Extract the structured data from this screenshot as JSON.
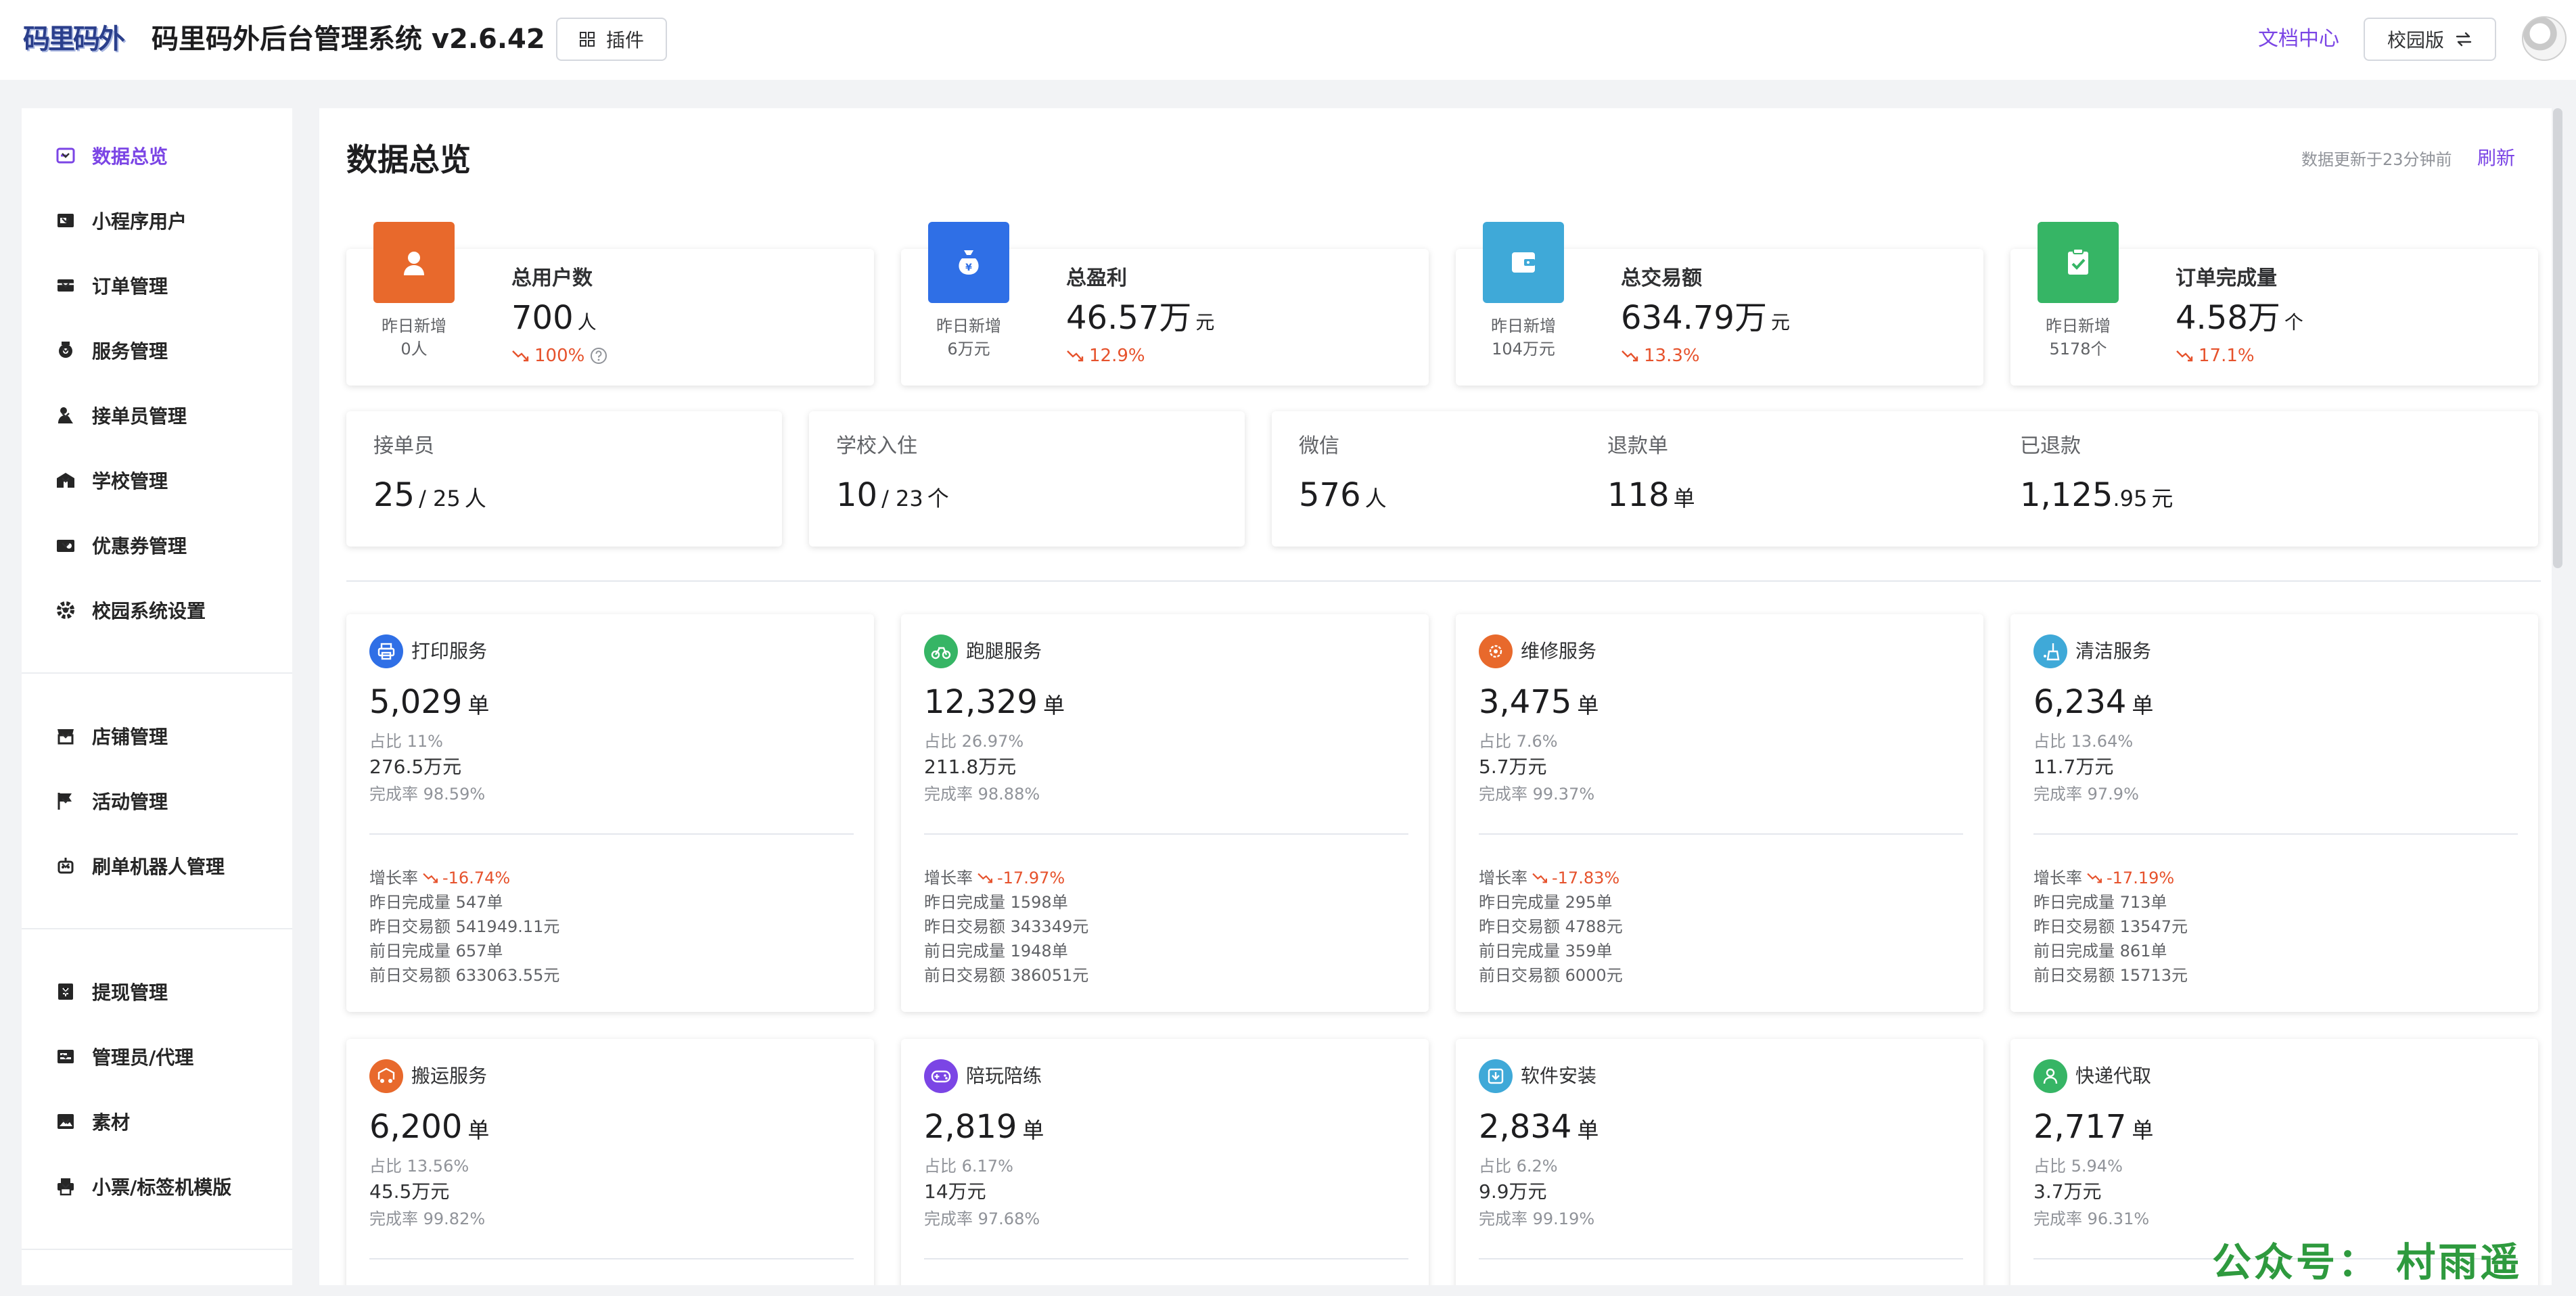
{
  "header": {
    "logo_text": "码里码外",
    "title": "码里码外后台管理系统 v2.6.42",
    "plugin_label": "插件",
    "docs_label": "文档中心",
    "school_label": "校园版"
  },
  "sidebar": {
    "groups": [
      [
        {
          "label": "数据总览",
          "icon": "dashboard-icon",
          "active": true
        },
        {
          "label": "小程序用户",
          "icon": "users-icon"
        },
        {
          "label": "订单管理",
          "icon": "orders-icon"
        },
        {
          "label": "服务管理",
          "icon": "service-icon"
        },
        {
          "label": "接单员管理",
          "icon": "runner-icon"
        },
        {
          "label": "学校管理",
          "icon": "school-icon"
        },
        {
          "label": "优惠券管理",
          "icon": "coupon-icon"
        },
        {
          "label": "校园系统设置",
          "icon": "settings-icon"
        }
      ],
      [
        {
          "label": "店铺管理",
          "icon": "shop-icon"
        },
        {
          "label": "活动管理",
          "icon": "flag-icon"
        },
        {
          "label": "刷单机器人管理",
          "icon": "robot-icon"
        }
      ],
      [
        {
          "label": "提现管理",
          "icon": "withdraw-icon"
        },
        {
          "label": "管理员/代理",
          "icon": "admin-icon"
        },
        {
          "label": "素材",
          "icon": "image-icon"
        },
        {
          "label": "小票/标签机模版",
          "icon": "printer-icon"
        }
      ]
    ]
  },
  "main": {
    "title": "数据总览",
    "updated_text": "数据更新于23分钟前",
    "refresh_label": "刷新"
  },
  "stats": [
    {
      "icon": "user-icon",
      "color": "#e8692c",
      "yesterday_label": "昨日新增",
      "yesterday_value": "0人",
      "label": "总用户数",
      "value": "700",
      "unit": "人",
      "trend": "100%",
      "help": true
    },
    {
      "icon": "money-bag-icon",
      "color": "#2f6fe6",
      "yesterday_label": "昨日新增",
      "yesterday_value": "6万元",
      "label": "总盈利",
      "value": "46.57万",
      "unit": "元",
      "trend": "12.9%"
    },
    {
      "icon": "wallet-icon",
      "color": "#3fa9d8",
      "yesterday_label": "昨日新增",
      "yesterday_value": "104万元",
      "label": "总交易额",
      "value": "634.79万",
      "unit": "元",
      "trend": "13.3%"
    },
    {
      "icon": "clipboard-check-icon",
      "color": "#36b565",
      "yesterday_label": "昨日新增",
      "yesterday_value": "5178个",
      "label": "订单完成量",
      "value": "4.58万",
      "unit": "个",
      "trend": "17.1%"
    }
  ],
  "metrics": {
    "runners": {
      "label": "接单员",
      "value": "25",
      "total": "/ 25",
      "unit": "人"
    },
    "schools": {
      "label": "学校入住",
      "value": "10",
      "total": "/ 23",
      "unit": "个"
    },
    "wechat": {
      "label": "微信",
      "value": "576",
      "unit": "人"
    },
    "refund_orders": {
      "label": "退款单",
      "value": "118",
      "unit": "单"
    },
    "refunded": {
      "label": "已退款",
      "value": "1,125",
      "decimal": ".95",
      "unit": "元"
    }
  },
  "services": [
    {
      "name": "打印服务",
      "icon": "printer-service-icon",
      "color": "#2f6fe6",
      "count": "5,029",
      "unit": "单",
      "pct": "占比 11%",
      "amount": "276.5万元",
      "completion": "完成率 98.59%",
      "growth_label": "增长率",
      "growth": "-16.74%",
      "d1": "昨日完成量 547单",
      "d2": "昨日交易额 541949.11元",
      "d3": "前日完成量 657单",
      "d4": "前日交易额 633063.55元"
    },
    {
      "name": "跑腿服务",
      "icon": "bike-icon",
      "color": "#36b565",
      "count": "12,329",
      "unit": "单",
      "pct": "占比 26.97%",
      "amount": "211.8万元",
      "completion": "完成率 98.88%",
      "growth_label": "增长率",
      "growth": "-17.97%",
      "d1": "昨日完成量 1598单",
      "d2": "昨日交易额 343349元",
      "d3": "前日完成量 1948单",
      "d4": "前日交易额 386051元"
    },
    {
      "name": "维修服务",
      "icon": "repair-icon",
      "color": "#e8692c",
      "count": "3,475",
      "unit": "单",
      "pct": "占比 7.6%",
      "amount": "5.7万元",
      "completion": "完成率 99.37%",
      "growth_label": "增长率",
      "growth": "-17.83%",
      "d1": "昨日完成量 295单",
      "d2": "昨日交易额 4788元",
      "d3": "前日完成量 359单",
      "d4": "前日交易额 6000元"
    },
    {
      "name": "清洁服务",
      "icon": "broom-icon",
      "color": "#3fa9d8",
      "count": "6,234",
      "unit": "单",
      "pct": "占比 13.64%",
      "amount": "11.7万元",
      "completion": "完成率 97.9%",
      "growth_label": "增长率",
      "growth": "-17.19%",
      "d1": "昨日完成量 713单",
      "d2": "昨日交易额 13547元",
      "d3": "前日完成量 861单",
      "d4": "前日交易额 15713元"
    },
    {
      "name": "搬运服务",
      "icon": "truck-icon",
      "color": "#e8692c",
      "count": "6,200",
      "unit": "单",
      "pct": "占比 13.56%",
      "amount": "45.5万元",
      "completion": "完成率 99.82%"
    },
    {
      "name": "陪玩陪练",
      "icon": "gamepad-icon",
      "color": "#7b45e5",
      "count": "2,819",
      "unit": "单",
      "pct": "占比 6.17%",
      "amount": "14万元",
      "completion": "完成率 97.68%"
    },
    {
      "name": "软件安装",
      "icon": "install-icon",
      "color": "#3fa9d8",
      "count": "2,834",
      "unit": "单",
      "pct": "占比 6.2%",
      "amount": "9.9万元",
      "completion": "完成率 99.19%"
    },
    {
      "name": "快递代取",
      "icon": "courier-icon",
      "color": "#36b565",
      "count": "2,717",
      "unit": "单",
      "pct": "占比 5.94%",
      "amount": "3.7万元",
      "completion": "完成率 96.31%"
    }
  ],
  "watermark": "公众号： 村雨遥"
}
